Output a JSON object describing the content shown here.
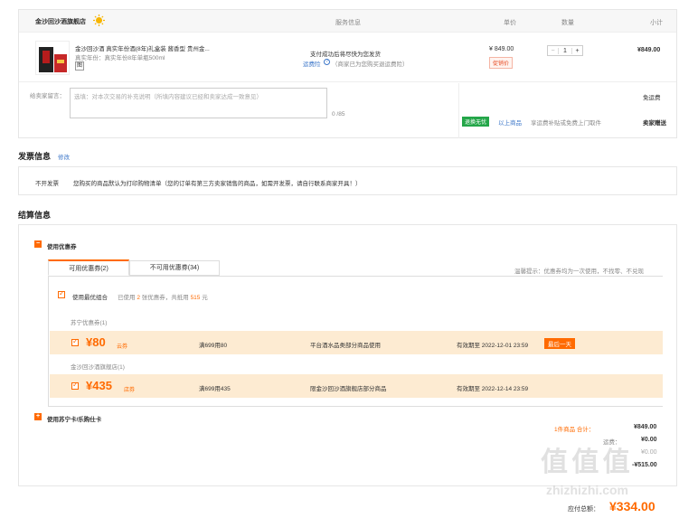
{
  "order_header": {
    "shop_name": "金沙回沙酒旗舰店",
    "col_service": "服务信息",
    "col_price": "单价",
    "col_qty": "数量",
    "col_subtotal": "小计"
  },
  "product": {
    "title": "金沙回沙酒 真实年份酒(8年)礼盒装 酱香型 贵州金...",
    "spec": "真实年份：真实年份8年单瓶500ml",
    "badge": "图",
    "service_line1": "支付成功后将尽快为您发货",
    "service_line2_label": "运费险",
    "service_line2_note": "（商家已为您购买退运费险）",
    "price": "¥ 849.00",
    "promo_tag": "促销价",
    "qty_minus": "−",
    "qty_value": "1",
    "qty_plus": "+",
    "subtotal": "¥849.00"
  },
  "message": {
    "label": "给卖家留言：",
    "placeholder": "选填：对本次交易的补充说明（所填内容建议已经和卖家达成一致意见）",
    "counter": "0 /85",
    "shipping_free": "免运费",
    "return_tag": "退换无忧",
    "return_link": "以上商品",
    "return_desc": "享运费补贴或免费上门取件",
    "seller_gift": "卖家赠送"
  },
  "invoice": {
    "title": "发票信息",
    "edit": "修改",
    "type": "不开发票",
    "desc": "您购买的商品默认为打印购物清单（您的订单有第三方卖家销售的商品，如需开发票，请自行联系商家开具！）"
  },
  "settlement": {
    "title": "结算信息",
    "use_coupon": "使用优惠券",
    "tab_available": "可用优惠券(2)",
    "tab_unavailable": "不可用优惠券(34)",
    "tip": "温馨提示：优惠券均为一次使用，不找零、不兑现",
    "best_combo_label": "使用最优组合",
    "best_combo_used_pre": "已使用",
    "best_combo_count": "2",
    "best_combo_used_mid": "张优惠券，共抵用",
    "best_combo_amount": "515",
    "best_combo_unit": "元",
    "group1": "苏宁优惠券(1)",
    "coupon1_amount": "¥80",
    "coupon1_type": "云券",
    "coupon1_rule": "满699用80",
    "coupon1_scope": "平台酒水品类部分商品使用",
    "coupon1_expiry": "有效期至 2022-12-01 23:59",
    "coupon1_ribbon": "最后一天",
    "group2": "金沙回沙酒旗舰店(1)",
    "coupon2_amount": "¥435",
    "coupon2_type": "店券",
    "coupon2_rule": "满699用435",
    "coupon2_scope": "限金沙回沙酒旗舰店部分商品",
    "coupon2_expiry": "有效期至 2022-12-14 23:59",
    "use_card": "使用苏宁卡/乐购仕卡"
  },
  "summary": {
    "items_label": "1件商品 合计：",
    "items_value": "¥849.00",
    "shipping_label": "运费：",
    "shipping_value": "¥0.00",
    "row3_value": "¥0.00",
    "row4_value": "-¥515.00",
    "payable_label": "应付总额：",
    "payable_value": "¥334.00"
  },
  "watermark": {
    "logo": "值 值 值",
    "domain": "zhizhizhi.com"
  },
  "colors": {
    "accent": "#ff6a00",
    "coupon_bg": "#fdebd2",
    "green": "#24a649",
    "link": "#3d77c9"
  }
}
